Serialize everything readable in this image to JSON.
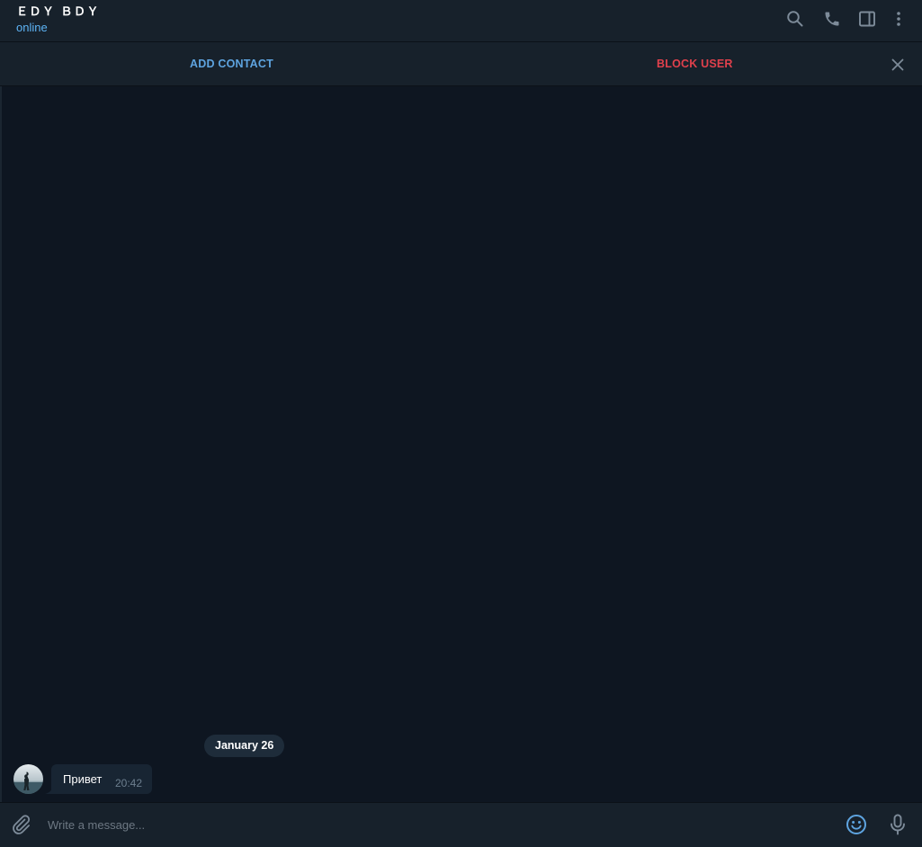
{
  "header": {
    "chat_name": "ＥＤＹ ＢＤＹ",
    "status": "online",
    "icons": [
      "search-icon",
      "phone-icon",
      "sidebar-icon",
      "more-vertical-icon"
    ]
  },
  "action_bar": {
    "add_contact_label": "ADD CONTACT",
    "block_user_label": "BLOCK USER",
    "close_icon": "close-icon"
  },
  "chat": {
    "date_separator": "January 26",
    "messages": [
      {
        "text": "Привет",
        "time": "20:42",
        "incoming": true
      }
    ]
  },
  "composer": {
    "placeholder": "Write a message...",
    "icons": [
      "paperclip-icon",
      "emoji-icon",
      "microphone-icon"
    ]
  },
  "colors": {
    "background": "#0e1621",
    "panel": "#17212b",
    "bubble": "#182533",
    "accent_blue": "#5ea4e0",
    "danger_red": "#e0404c",
    "icon_gray": "#7d8b99"
  }
}
